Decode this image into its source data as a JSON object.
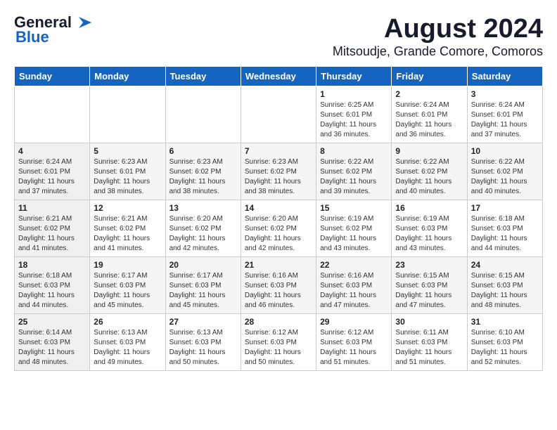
{
  "header": {
    "logo_line1": "General",
    "logo_line2": "Blue",
    "title": "August 2024",
    "subtitle": "Mitsoudje, Grande Comore, Comoros"
  },
  "days_of_week": [
    "Sunday",
    "Monday",
    "Tuesday",
    "Wednesday",
    "Thursday",
    "Friday",
    "Saturday"
  ],
  "weeks": [
    [
      {
        "day": "",
        "info": ""
      },
      {
        "day": "",
        "info": ""
      },
      {
        "day": "",
        "info": ""
      },
      {
        "day": "",
        "info": ""
      },
      {
        "day": "1",
        "info": "Sunrise: 6:25 AM\nSunset: 6:01 PM\nDaylight: 11 hours and 36 minutes."
      },
      {
        "day": "2",
        "info": "Sunrise: 6:24 AM\nSunset: 6:01 PM\nDaylight: 11 hours and 36 minutes."
      },
      {
        "day": "3",
        "info": "Sunrise: 6:24 AM\nSunset: 6:01 PM\nDaylight: 11 hours and 37 minutes."
      }
    ],
    [
      {
        "day": "4",
        "info": "Sunrise: 6:24 AM\nSunset: 6:01 PM\nDaylight: 11 hours and 37 minutes."
      },
      {
        "day": "5",
        "info": "Sunrise: 6:23 AM\nSunset: 6:01 PM\nDaylight: 11 hours and 38 minutes."
      },
      {
        "day": "6",
        "info": "Sunrise: 6:23 AM\nSunset: 6:02 PM\nDaylight: 11 hours and 38 minutes."
      },
      {
        "day": "7",
        "info": "Sunrise: 6:23 AM\nSunset: 6:02 PM\nDaylight: 11 hours and 38 minutes."
      },
      {
        "day": "8",
        "info": "Sunrise: 6:22 AM\nSunset: 6:02 PM\nDaylight: 11 hours and 39 minutes."
      },
      {
        "day": "9",
        "info": "Sunrise: 6:22 AM\nSunset: 6:02 PM\nDaylight: 11 hours and 40 minutes."
      },
      {
        "day": "10",
        "info": "Sunrise: 6:22 AM\nSunset: 6:02 PM\nDaylight: 11 hours and 40 minutes."
      }
    ],
    [
      {
        "day": "11",
        "info": "Sunrise: 6:21 AM\nSunset: 6:02 PM\nDaylight: 11 hours and 41 minutes."
      },
      {
        "day": "12",
        "info": "Sunrise: 6:21 AM\nSunset: 6:02 PM\nDaylight: 11 hours and 41 minutes."
      },
      {
        "day": "13",
        "info": "Sunrise: 6:20 AM\nSunset: 6:02 PM\nDaylight: 11 hours and 42 minutes."
      },
      {
        "day": "14",
        "info": "Sunrise: 6:20 AM\nSunset: 6:02 PM\nDaylight: 11 hours and 42 minutes."
      },
      {
        "day": "15",
        "info": "Sunrise: 6:19 AM\nSunset: 6:02 PM\nDaylight: 11 hours and 43 minutes."
      },
      {
        "day": "16",
        "info": "Sunrise: 6:19 AM\nSunset: 6:03 PM\nDaylight: 11 hours and 43 minutes."
      },
      {
        "day": "17",
        "info": "Sunrise: 6:18 AM\nSunset: 6:03 PM\nDaylight: 11 hours and 44 minutes."
      }
    ],
    [
      {
        "day": "18",
        "info": "Sunrise: 6:18 AM\nSunset: 6:03 PM\nDaylight: 11 hours and 44 minutes."
      },
      {
        "day": "19",
        "info": "Sunrise: 6:17 AM\nSunset: 6:03 PM\nDaylight: 11 hours and 45 minutes."
      },
      {
        "day": "20",
        "info": "Sunrise: 6:17 AM\nSunset: 6:03 PM\nDaylight: 11 hours and 45 minutes."
      },
      {
        "day": "21",
        "info": "Sunrise: 6:16 AM\nSunset: 6:03 PM\nDaylight: 11 hours and 46 minutes."
      },
      {
        "day": "22",
        "info": "Sunrise: 6:16 AM\nSunset: 6:03 PM\nDaylight: 11 hours and 47 minutes."
      },
      {
        "day": "23",
        "info": "Sunrise: 6:15 AM\nSunset: 6:03 PM\nDaylight: 11 hours and 47 minutes."
      },
      {
        "day": "24",
        "info": "Sunrise: 6:15 AM\nSunset: 6:03 PM\nDaylight: 11 hours and 48 minutes."
      }
    ],
    [
      {
        "day": "25",
        "info": "Sunrise: 6:14 AM\nSunset: 6:03 PM\nDaylight: 11 hours and 48 minutes."
      },
      {
        "day": "26",
        "info": "Sunrise: 6:13 AM\nSunset: 6:03 PM\nDaylight: 11 hours and 49 minutes."
      },
      {
        "day": "27",
        "info": "Sunrise: 6:13 AM\nSunset: 6:03 PM\nDaylight: 11 hours and 50 minutes."
      },
      {
        "day": "28",
        "info": "Sunrise: 6:12 AM\nSunset: 6:03 PM\nDaylight: 11 hours and 50 minutes."
      },
      {
        "day": "29",
        "info": "Sunrise: 6:12 AM\nSunset: 6:03 PM\nDaylight: 11 hours and 51 minutes."
      },
      {
        "day": "30",
        "info": "Sunrise: 6:11 AM\nSunset: 6:03 PM\nDaylight: 11 hours and 51 minutes."
      },
      {
        "day": "31",
        "info": "Sunrise: 6:10 AM\nSunset: 6:03 PM\nDaylight: 11 hours and 52 minutes."
      }
    ]
  ]
}
